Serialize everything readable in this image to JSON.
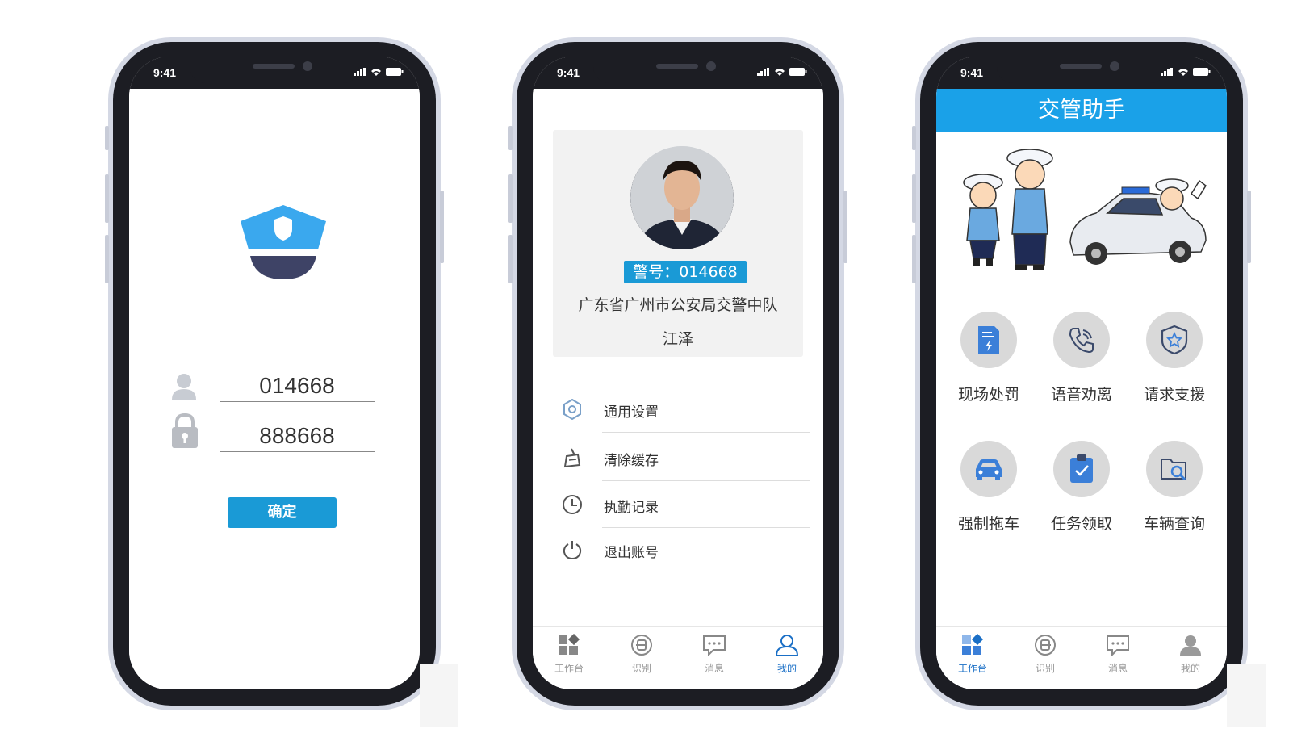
{
  "status": {
    "time": "9:41"
  },
  "login": {
    "username_value": "014668",
    "password_value": "888668",
    "confirm_label": "确定"
  },
  "profile": {
    "badge_label": "警号：014668",
    "unit": "广东省广州市公安局交警中队",
    "name": "江泽",
    "menu": [
      {
        "label": "通用设置",
        "icon": "gear-icon"
      },
      {
        "label": "清除缓存",
        "icon": "broom-icon"
      },
      {
        "label": "执勤记录",
        "icon": "clock-icon"
      },
      {
        "label": "退出账号",
        "icon": "power-icon"
      }
    ]
  },
  "tabs": [
    {
      "label": "工作台",
      "icon": "workbench-icon"
    },
    {
      "label": "识别",
      "icon": "scan-icon"
    },
    {
      "label": "消息",
      "icon": "message-icon"
    },
    {
      "label": "我的",
      "icon": "user-icon"
    }
  ],
  "home": {
    "title": "交管助手",
    "features": [
      {
        "label": "现场处罚",
        "icon": "ticket-icon"
      },
      {
        "label": "语音劝离",
        "icon": "phone-icon"
      },
      {
        "label": "请求支援",
        "icon": "shield-star-icon"
      },
      {
        "label": "强制拖车",
        "icon": "car-icon"
      },
      {
        "label": "任务领取",
        "icon": "clipboard-icon"
      },
      {
        "label": "车辆查询",
        "icon": "search-folder-icon"
      }
    ]
  },
  "colors": {
    "accent": "#1a9ad6",
    "appbar": "#1aa1e8",
    "active_tab": "#1a6fc6"
  }
}
